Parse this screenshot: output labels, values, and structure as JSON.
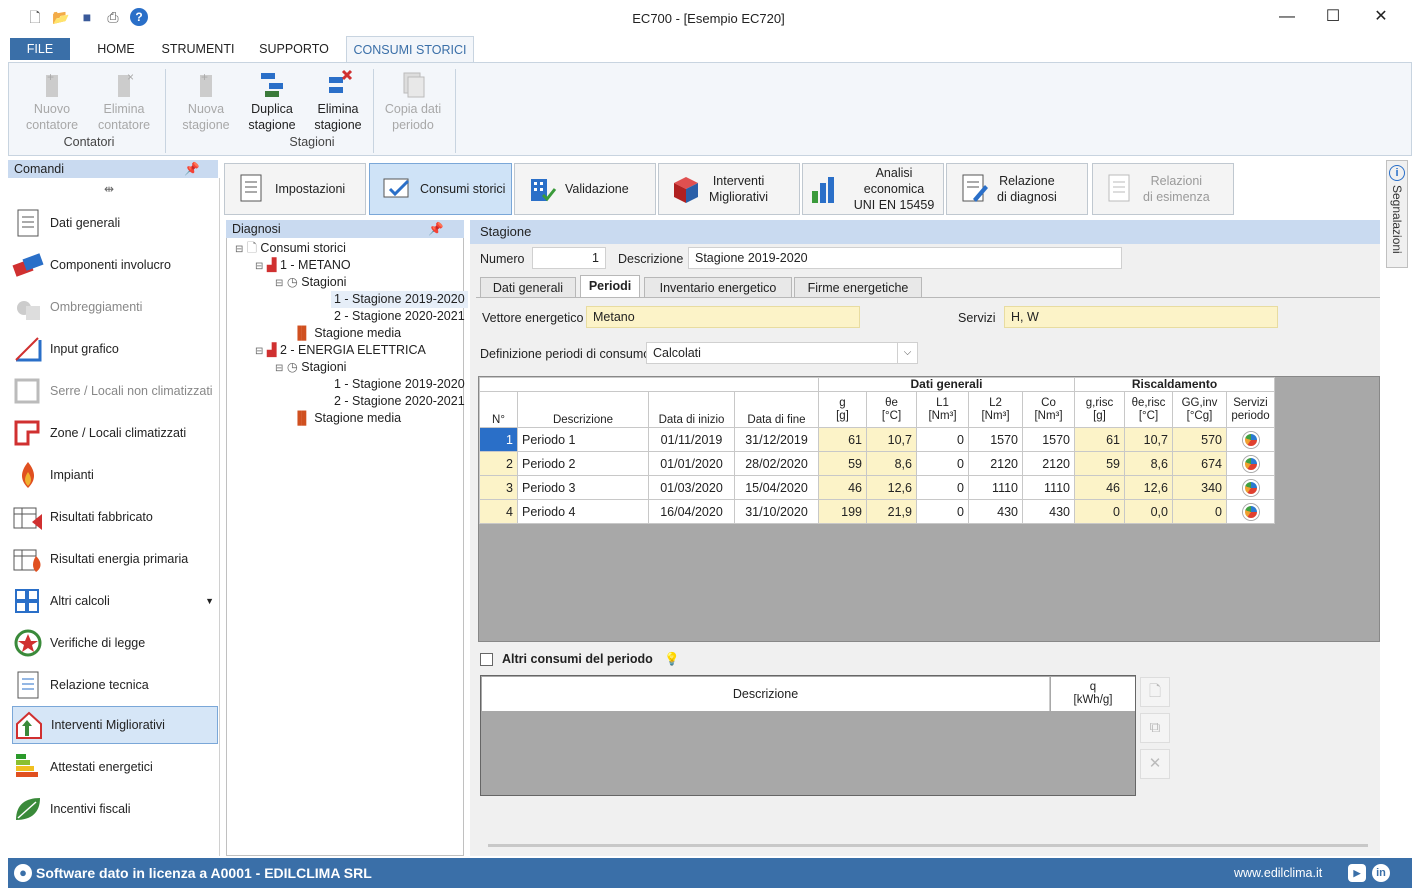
{
  "window": {
    "title": "EC700 - [Esempio EC720]"
  },
  "menu": {
    "file": "FILE",
    "home": "HOME",
    "strumenti": "STRUMENTI",
    "supporto": "SUPPORTO",
    "consumi": "CONSUMI STORICI"
  },
  "ribbon": {
    "nuovo_contatore": [
      "Nuovo",
      "contatore"
    ],
    "elimina_contatore": [
      "Elimina",
      "contatore"
    ],
    "group_contatori": "Contatori",
    "nuova_stagione": [
      "Nuova",
      "stagione"
    ],
    "duplica_stagione": [
      "Duplica",
      "stagione"
    ],
    "elimina_stagione": [
      "Elimina",
      "stagione"
    ],
    "copia_dati": [
      "Copia dati",
      "periodo"
    ],
    "group_stagioni": "Stagioni"
  },
  "commands": {
    "header": "Comandi",
    "items": [
      {
        "label": "Dati generali"
      },
      {
        "label": "Componenti involucro"
      },
      {
        "label": "Ombreggiamenti"
      },
      {
        "label": "Input grafico"
      },
      {
        "label": "Serre / Locali non climatizzati"
      },
      {
        "label": "Zone / Locali climatizzati"
      },
      {
        "label": "Impianti"
      },
      {
        "label": "Risultati fabbricato"
      },
      {
        "label": "Risultati energia primaria"
      },
      {
        "label": "Altri calcoli"
      },
      {
        "label": "Verifiche di legge"
      },
      {
        "label": "Relazione tecnica"
      },
      {
        "label": "Interventi Migliorativi"
      },
      {
        "label": "Attestati energetici"
      },
      {
        "label": "Incentivi fiscali"
      }
    ]
  },
  "toolbar": {
    "impostazioni": "Impostazioni",
    "consumi": "Consumi storici",
    "validazione": "Validazione",
    "interventi": [
      "Interventi",
      "Migliorativi"
    ],
    "analisi": [
      "Analisi economica",
      "UNI EN 15459"
    ],
    "relazione": [
      "Relazione",
      "di diagnosi"
    ],
    "esimenza": [
      "Relazioni",
      "di esimenza"
    ]
  },
  "diagnosi": {
    "header": "Diagnosi",
    "tree": [
      "Consumi storici",
      "1 - METANO",
      "Stagioni",
      "1 - Stagione 2019-2020",
      "2 - Stagione 2020-2021",
      "Stagione media",
      "2 - ENERGIA ELETTRICA",
      "Stagioni",
      "1 - Stagione 2019-2020",
      "2 - Stagione 2020-2021",
      "Stagione media"
    ]
  },
  "stagione": {
    "header": "Stagione",
    "numero_label": "Numero",
    "numero": "1",
    "descrizione_label": "Descrizione",
    "descrizione": "Stagione 2019-2020",
    "tabs": [
      "Dati generali",
      "Periodi",
      "Inventario energetico",
      "Firme energetiche"
    ],
    "vettore_label": "Vettore energetico",
    "vettore": "Metano",
    "servizi_label": "Servizi",
    "servizi": "H, W",
    "definizione_label": "Definizione periodi di consumo",
    "definizione": "Calcolati"
  },
  "grid": {
    "group_dati": "Dati generali",
    "group_risc": "Riscaldamento",
    "headers": {
      "n": "N°",
      "descr": "Descrizione",
      "inizio": "Data di inizio",
      "fine": "Data di fine",
      "g": [
        "g",
        "[g]"
      ],
      "te": [
        "θe",
        "[°C]"
      ],
      "l1": [
        "L1",
        "[Nm³]"
      ],
      "l2": [
        "L2",
        "[Nm³]"
      ],
      "co": [
        "Co",
        "[Nm³]"
      ],
      "grisc": [
        "g,risc",
        "[g]"
      ],
      "terisc": [
        "θe,risc",
        "[°C]"
      ],
      "gg": [
        "GG,inv",
        "[°Cg]"
      ],
      "serv": [
        "Servizi",
        "periodo"
      ]
    },
    "rows": [
      [
        "1",
        "Periodo 1",
        "01/11/2019",
        "31/12/2019",
        "61",
        "10,7",
        "0",
        "1570",
        "1570",
        "61",
        "10,7",
        "570"
      ],
      [
        "2",
        "Periodo 2",
        "01/01/2020",
        "28/02/2020",
        "59",
        "8,6",
        "0",
        "2120",
        "2120",
        "59",
        "8,6",
        "674"
      ],
      [
        "3",
        "Periodo 3",
        "01/03/2020",
        "15/04/2020",
        "46",
        "12,6",
        "0",
        "1110",
        "1110",
        "46",
        "12,6",
        "340"
      ],
      [
        "4",
        "Periodo 4",
        "16/04/2020",
        "31/10/2020",
        "199",
        "21,9",
        "0",
        "430",
        "430",
        "0",
        "0,0",
        "0"
      ]
    ]
  },
  "altri": {
    "label": "Altri consumi del periodo",
    "col_descr": "Descrizione",
    "col_q": [
      "q",
      "[kWh/g]"
    ]
  },
  "sidetab": "Segnalazioni",
  "status": {
    "left": "Software dato in licenza a A0001 - EDILCLIMA SRL",
    "right": "www.edilclima.it"
  },
  "colors": {
    "accent": "#3a6fa8",
    "highlight": "#c9daf0",
    "input_yellow": "#fcf3c8"
  }
}
